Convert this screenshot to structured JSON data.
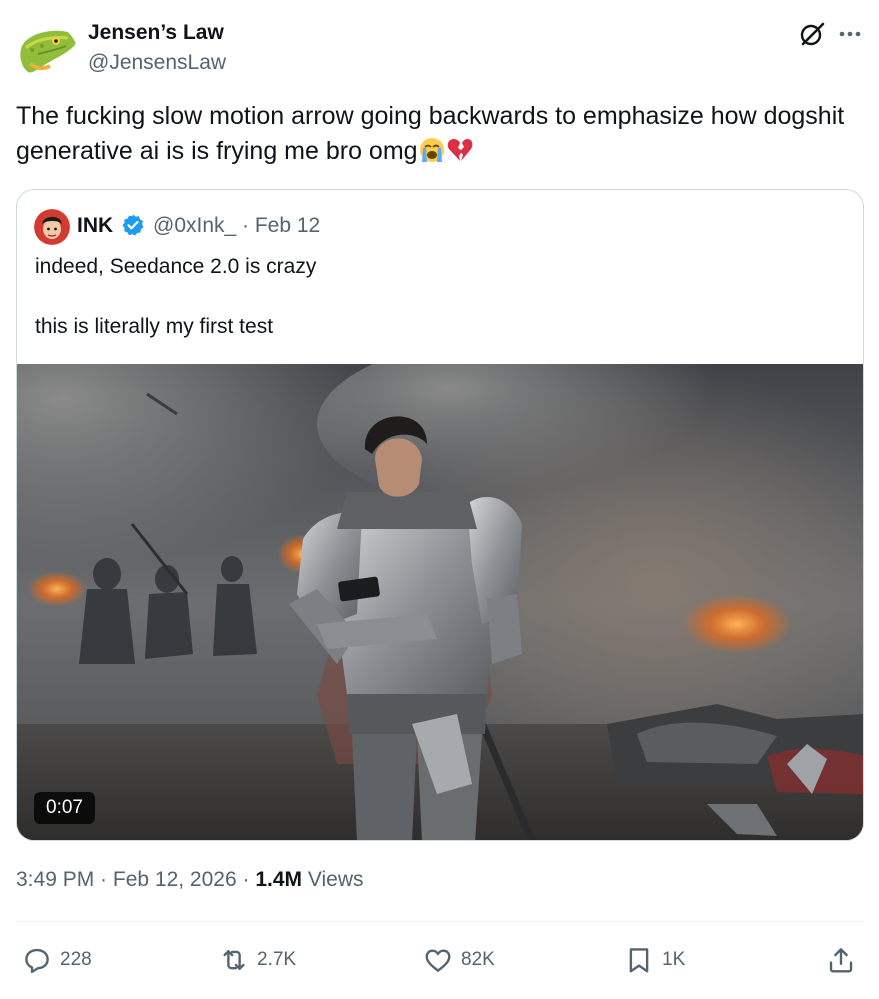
{
  "post": {
    "author_name": "Jensen’s Law",
    "author_handle": "@JensensLaw",
    "text": "The fucking slow motion arrow going backwards to emphasize how dogshit generative ai is is frying me bro omg",
    "emojis": [
      "loudly-crying-face",
      "broken-heart"
    ],
    "timestamp": "3:49 PM · Feb 12, 2026",
    "separator": " · ",
    "views_count": "1.4M",
    "views_label": "Views"
  },
  "quote": {
    "name": "INK",
    "verified": true,
    "handle_date": "@0xInk_ · Feb 12",
    "lines": [
      "indeed, Seedance 2.0 is crazy",
      "this is literally my first test"
    ],
    "video_duration": "0:07"
  },
  "actions": {
    "reply_count": "228",
    "repost_count": "2.7K",
    "like_count": "82K",
    "bookmark_count": "1K"
  },
  "colors": {
    "text_primary": "#0f1419",
    "text_secondary": "#536471",
    "border": "#cfd9de",
    "verified_blue": "#1d9bf0"
  },
  "icons": [
    "grok-icon",
    "more-icon",
    "verified-badge-icon",
    "reply-icon",
    "repost-icon",
    "like-icon",
    "bookmark-icon",
    "share-icon"
  ]
}
